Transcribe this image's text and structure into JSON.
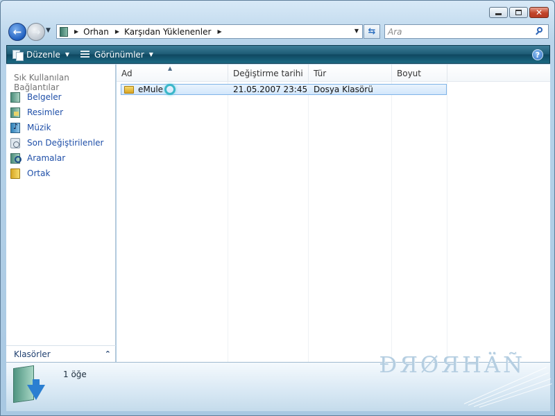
{
  "window": {
    "caption_buttons": {
      "minimize": "minimize",
      "maximize": "maximize",
      "close": "✕"
    }
  },
  "address": {
    "breadcrumbs": [
      "Orhan",
      "Karşıdan Yüklenenler"
    ],
    "search_placeholder": "Ara"
  },
  "toolbar": {
    "organize_label": "Düzenle",
    "views_label": "Görünümler",
    "help": "?"
  },
  "nav": {
    "heading": "Sık Kullanılan Bağlantılar",
    "items": [
      {
        "label": "Belgeler",
        "icon": "documents-icon"
      },
      {
        "label": "Resimler",
        "icon": "pictures-icon"
      },
      {
        "label": "Müzik",
        "icon": "music-icon"
      },
      {
        "label": "Son Değiştirilenler",
        "icon": "recent-icon"
      },
      {
        "label": "Aramalar",
        "icon": "searches-icon"
      },
      {
        "label": "Ortak",
        "icon": "public-icon"
      }
    ],
    "folders_label": "Klasörler"
  },
  "file_list": {
    "columns": [
      "Ad",
      "Değiştirme tarihi",
      "Tür",
      "Boyut"
    ],
    "rows": [
      {
        "name": "eMule",
        "modified": "21.05.2007 23:45",
        "type": "Dosya Klasörü",
        "size": ""
      }
    ]
  },
  "details": {
    "item_count": "1 öğe",
    "watermark": "ĐЯØЯHÄÑ"
  },
  "colors": {
    "toolbar": "#1c5a74",
    "link": "#1f4fa8",
    "selection": "#d3e7fb"
  }
}
